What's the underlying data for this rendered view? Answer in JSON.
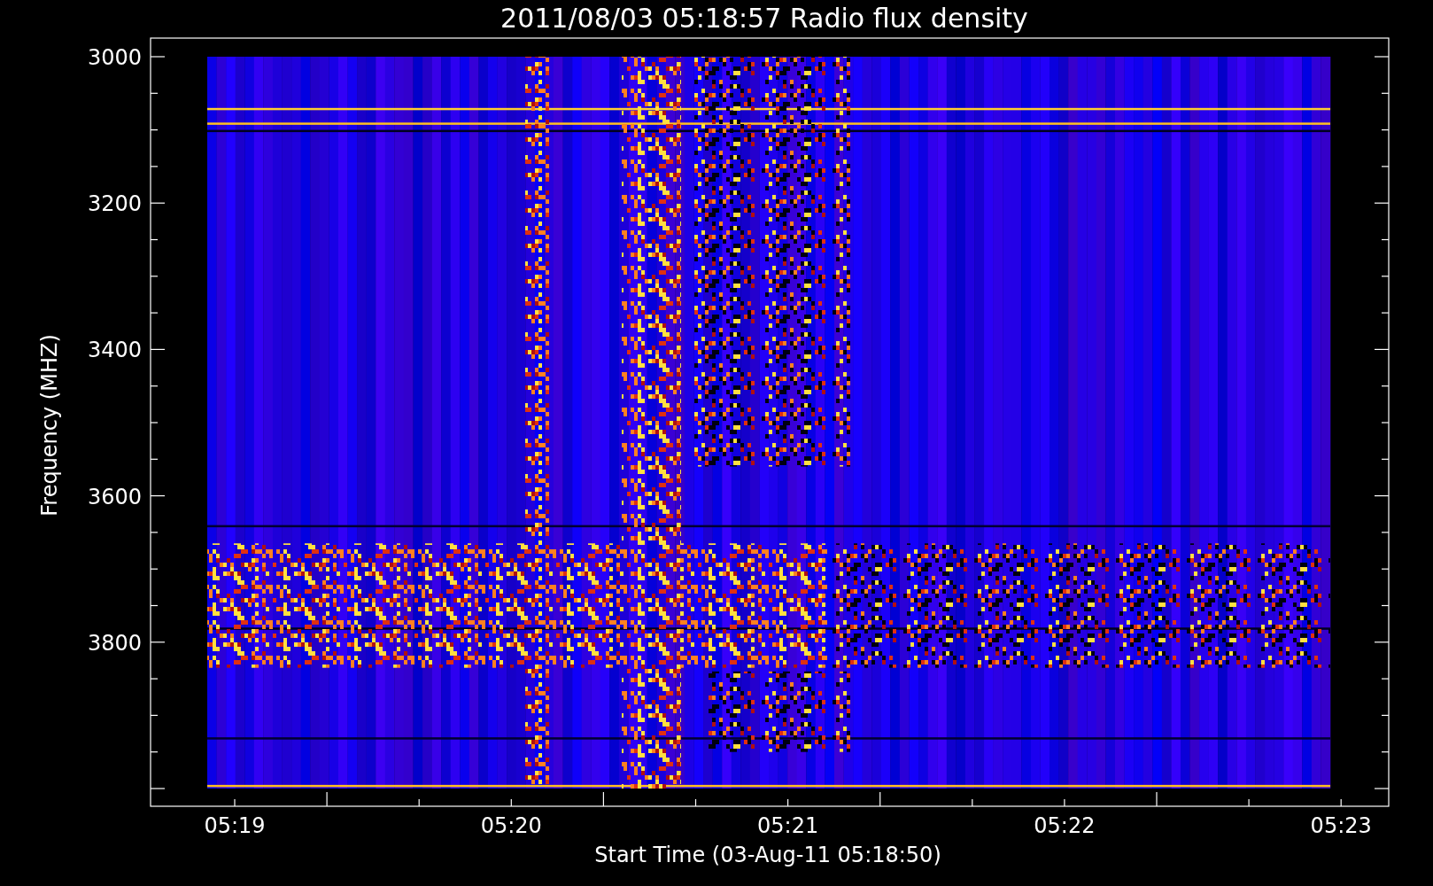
{
  "title": "2011/08/03 05:18:57 Radio flux density",
  "plot": {
    "ylabel": "Frequency (MHZ)",
    "xlabel": "Start Time (03-Aug-11 05:18:50)",
    "yticks": [
      "3000",
      "3200",
      "3400",
      "3600",
      "3800"
    ],
    "xticks": [
      "05:19",
      "05:20",
      "05:21",
      "05:22",
      "05:23"
    ]
  }
}
